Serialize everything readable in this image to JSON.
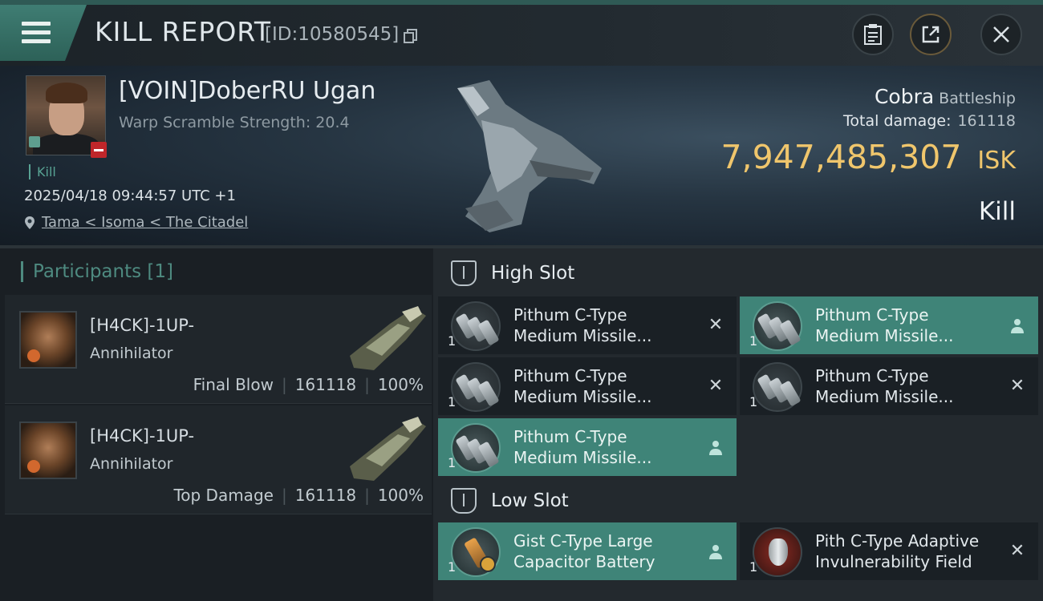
{
  "header": {
    "title": "KILL REPORT",
    "report_id": "[ID:10580545]"
  },
  "victim": {
    "name": "[VOIN]DoberRU Ugan",
    "warp_scramble": "Warp Scramble Strength: 20.4",
    "tag": "Kill",
    "datetime": "2025/04/18 09:44:57 UTC +1",
    "location": "Tama < Isoma < The Citadel"
  },
  "ship": {
    "name": "Cobra",
    "class": "Battleship",
    "total_damage_label": "Total damage:",
    "total_damage": "161118",
    "isk_value": "7,947,485,307",
    "isk_unit": "ISK",
    "outcome": "Kill"
  },
  "participants": {
    "title": "Participants [1]",
    "items": [
      {
        "name": "[H4CK]-1UP-",
        "ship": "Annihilator",
        "role": "Final Blow",
        "damage": "161118",
        "percent": "100%"
      },
      {
        "name": "[H4CK]-1UP-",
        "ship": "Annihilator",
        "role": "Top Damage",
        "damage": "161118",
        "percent": "100%"
      }
    ]
  },
  "slots": {
    "high": {
      "label": "High Slot",
      "modules": [
        {
          "line1": "Pithum C-Type",
          "line2": "Medium Missile...",
          "qty": "1",
          "state": "destroyed"
        },
        {
          "line1": "Pithum C-Type",
          "line2": "Medium Missile...",
          "qty": "1",
          "state": "dropped"
        },
        {
          "line1": "Pithum C-Type",
          "line2": "Medium Missile...",
          "qty": "1",
          "state": "destroyed"
        },
        {
          "line1": "Pithum C-Type",
          "line2": "Medium Missile...",
          "qty": "1",
          "state": "destroyed"
        },
        {
          "line1": "Pithum C-Type",
          "line2": "Medium Missile...",
          "qty": "1",
          "state": "dropped"
        }
      ]
    },
    "low": {
      "label": "Low Slot",
      "modules": [
        {
          "line1": "Gist C-Type Large",
          "line2": "Capacitor Battery",
          "qty": "1",
          "state": "dropped"
        },
        {
          "line1": "Pith C-Type Adaptive",
          "line2": "Invulnerability Field",
          "qty": "1",
          "state": "destroyed"
        }
      ]
    }
  },
  "colors": {
    "accent_teal": "#3f8478",
    "isk_gold": "#f0c66c",
    "alert_red": "#c0262a"
  }
}
